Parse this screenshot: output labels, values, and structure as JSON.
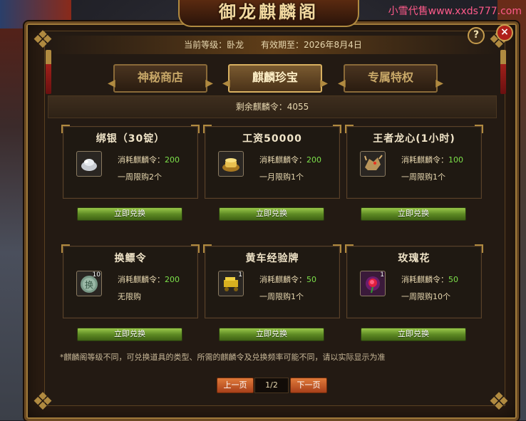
{
  "watermark": "小雪代售www.xxds777.com",
  "title": "御龙麒麟阁",
  "info": {
    "level_label": "当前等级：卧龙",
    "expiry_label": "有效期至：2026年8月4日"
  },
  "tabs": [
    {
      "label": "神秘商店",
      "active": false
    },
    {
      "label": "麒麟珍宝",
      "active": true
    },
    {
      "label": "专属特权",
      "active": false
    }
  ],
  "remaining": "剩余麒麟令：4055",
  "cost_prefix": "消耗麒麟令：",
  "exchange_label": "立即兑换",
  "items": [
    {
      "name": "绑银（30锭）",
      "icon": "silver-ingot-icon",
      "cost": "200",
      "limit": "一周限购2个",
      "count": ""
    },
    {
      "name": "工资50000",
      "icon": "gold-ingot-icon",
      "cost": "200",
      "limit": "一月限购1个",
      "count": ""
    },
    {
      "name": "王者龙心(1小时)",
      "icon": "dragon-head-icon",
      "cost": "100",
      "limit": "一周限购1个",
      "count": ""
    },
    {
      "name": "换鳔令",
      "icon": "jade-token-icon",
      "cost": "200",
      "limit": "无限购",
      "count": "10"
    },
    {
      "name": "黄车经验牌",
      "icon": "yellow-cart-icon",
      "cost": "50",
      "limit": "一周限购1个",
      "count": "1"
    },
    {
      "name": "玫瑰花",
      "icon": "rose-icon",
      "cost": "50",
      "limit": "一周限购10个",
      "count": "1"
    }
  ],
  "note": "*麒麟阁等级不同，可兑换道具的类型、所需的麒麟令及兑换频率可能不同，请以实际显示为准",
  "pager": {
    "prev": "上一页",
    "page": "1/2",
    "next": "下一页"
  },
  "controls": {
    "help": "?",
    "close": "×"
  }
}
